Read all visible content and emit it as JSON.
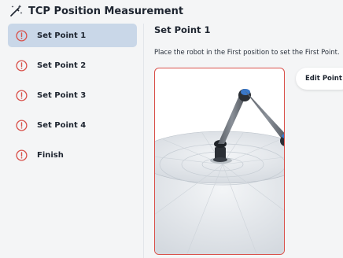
{
  "header": {
    "title": "TCP Position Measurement",
    "icon": "magic-wand-icon"
  },
  "steps": [
    {
      "label": "Set Point 1",
      "status": "warning",
      "active": true
    },
    {
      "label": "Set Point 2",
      "status": "warning",
      "active": false
    },
    {
      "label": "Set Point 3",
      "status": "warning",
      "active": false
    },
    {
      "label": "Set Point 4",
      "status": "warning",
      "active": false
    },
    {
      "label": "Finish",
      "status": "warning",
      "active": false
    }
  ],
  "content": {
    "title": "Set Point 1",
    "description": "Place the robot in the First position to set the First Point.",
    "edit_button": "Edit Point"
  },
  "colors": {
    "warning": "#d9504a",
    "active_step_bg": "#c9d7e8",
    "robot_joint_blue": "#3a78c9",
    "card_border": "#d9504a"
  }
}
